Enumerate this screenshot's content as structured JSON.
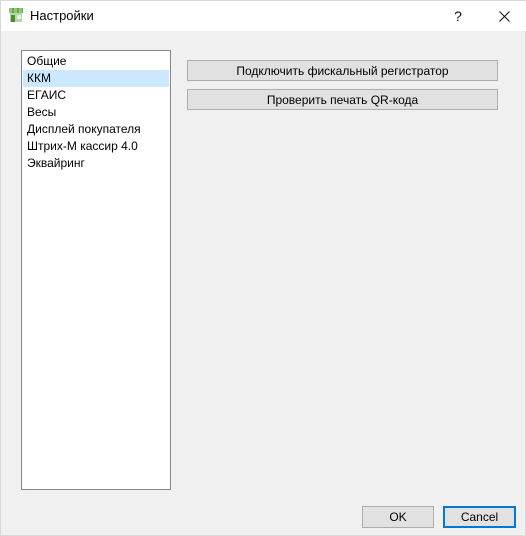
{
  "window": {
    "title": "Настройки",
    "help_label": "?",
    "close_label": "✕"
  },
  "nav": {
    "items": [
      {
        "label": "Общие",
        "selected": false
      },
      {
        "label": "ККМ",
        "selected": true
      },
      {
        "label": "ЕГАИС",
        "selected": false
      },
      {
        "label": "Весы",
        "selected": false
      },
      {
        "label": "Дисплей покупателя",
        "selected": false
      },
      {
        "label": "Штрих-М кассир 4.0",
        "selected": false
      },
      {
        "label": "Эквайринг",
        "selected": false
      }
    ]
  },
  "actions": {
    "connect_fiscal_label": "Подключить фискальный регистратор",
    "check_qr_label": "Проверить печать QR-кода"
  },
  "footer": {
    "ok_label": "OK",
    "cancel_label": "Cancel"
  },
  "colors": {
    "selection": "#cce8ff",
    "accent": "#0078d7",
    "button_face": "#e1e1e1",
    "background": "#f0f0f0"
  },
  "icons": {
    "app": "store-icon"
  }
}
